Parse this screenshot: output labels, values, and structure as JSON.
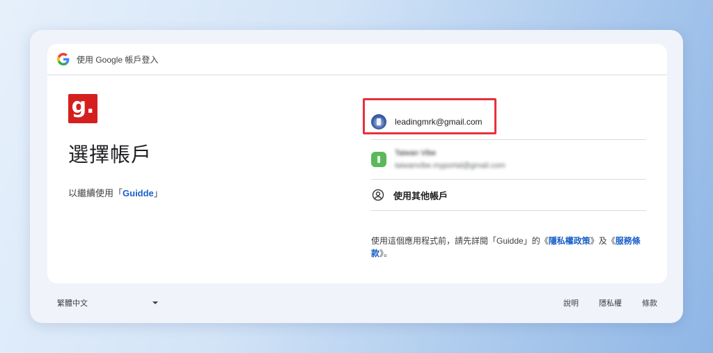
{
  "header": {
    "title": "使用 Google 帳戶登入",
    "logo_icon": "google-g-icon"
  },
  "app": {
    "logo_letter": "g.",
    "logo_color": "#d51f1f",
    "name": "Guidde"
  },
  "main": {
    "title": "選擇帳戶",
    "subtitle_prefix": "以繼續使用「",
    "subtitle_app": "Guidde",
    "subtitle_suffix": "」"
  },
  "accounts": [
    {
      "email": "leadingmrk@gmail.com",
      "highlighted": true
    },
    {
      "name": "Taiwan Vibe",
      "email": "taiwanvibe.myportal@gmail.com",
      "blurred": true
    }
  ],
  "other_account": {
    "label": "使用其他帳戶",
    "icon": "person-circle-icon"
  },
  "privacy": {
    "text_before": "使用這個應用程式前，請先詳閱「Guidde」的《",
    "privacy_link": "隱私權政策",
    "text_mid": "》及《",
    "terms_link": "服務條款",
    "text_after": "》。"
  },
  "footer": {
    "language": "繁體中文",
    "links": [
      "說明",
      "隱私權",
      "條款"
    ]
  },
  "colors": {
    "accent": "#1a5fc9",
    "highlight": "#e8303a"
  }
}
